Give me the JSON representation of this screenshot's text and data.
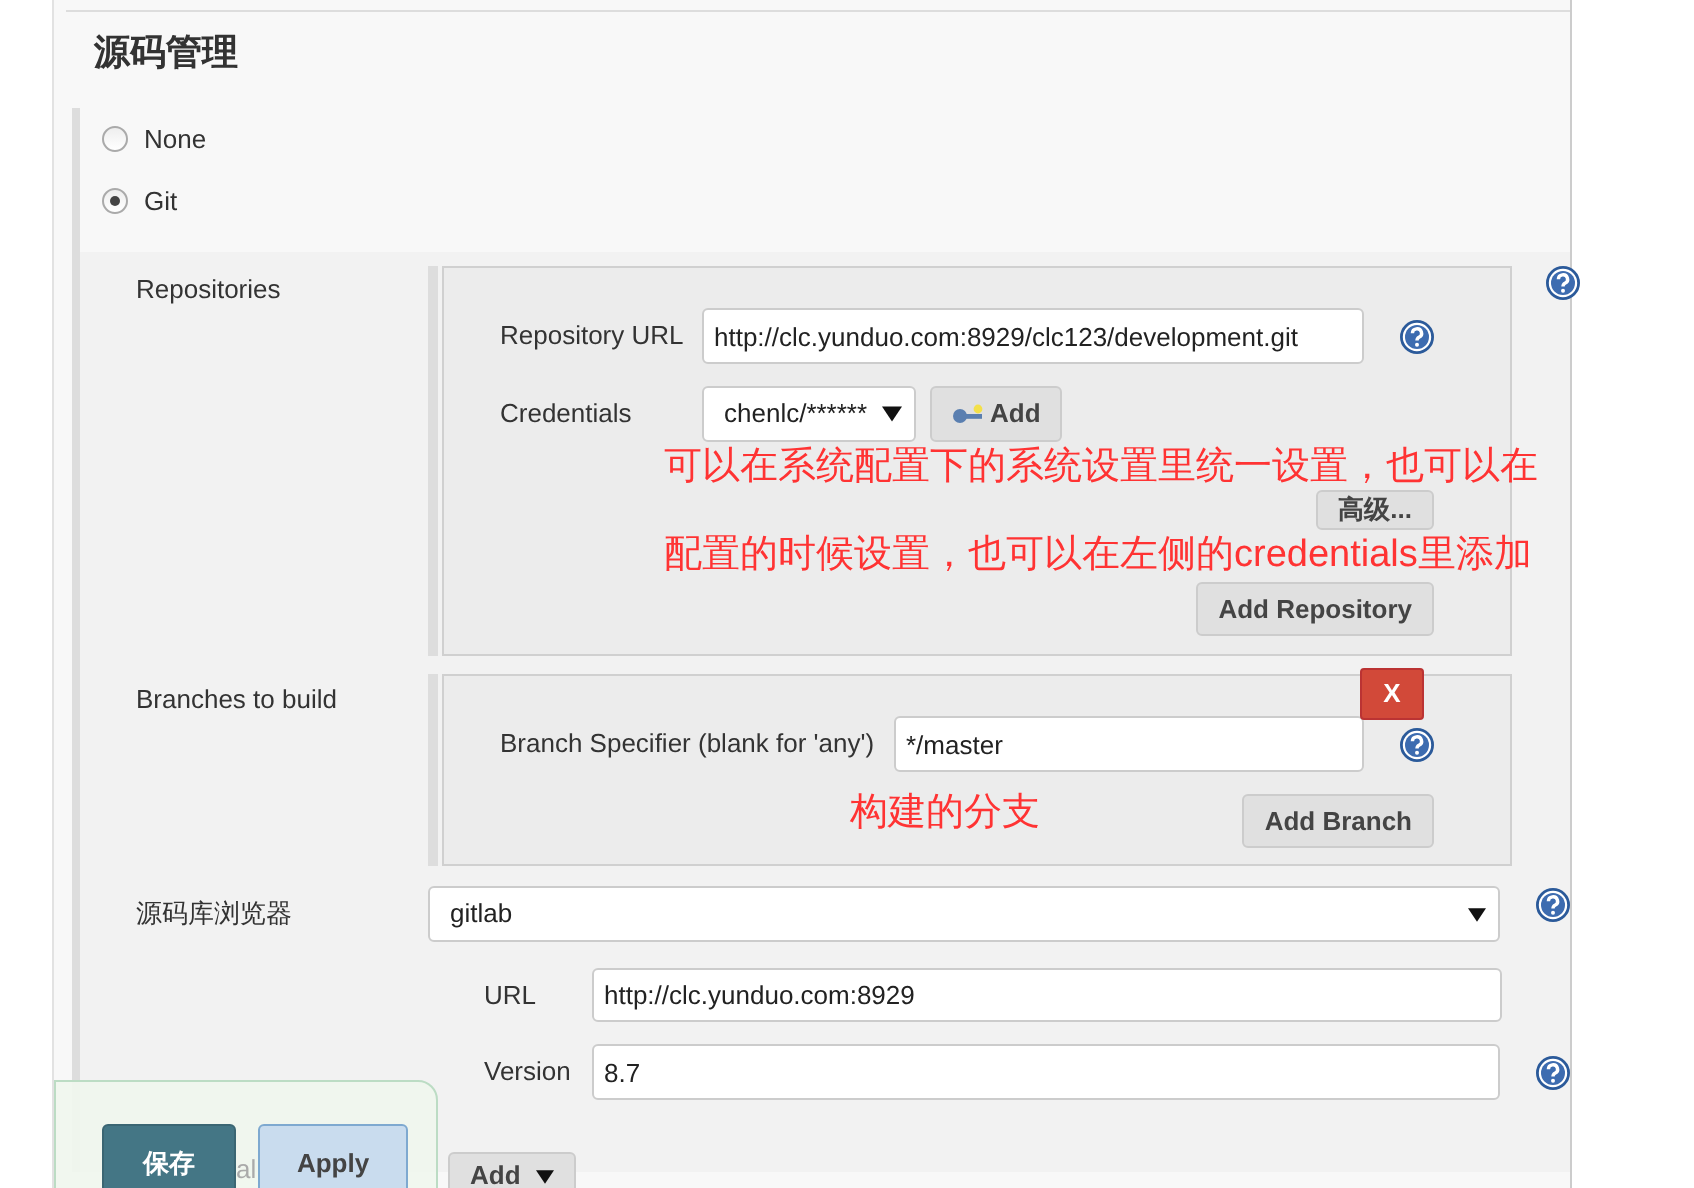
{
  "section_title": "源码管理",
  "scm_options": [
    {
      "label": "None",
      "selected": false
    },
    {
      "label": "Git",
      "selected": true
    }
  ],
  "repositories": {
    "label": "Repositories",
    "url_label": "Repository URL",
    "url": "http://clc.yunduo.com:8929/clc123/development.git",
    "credentials_label": "Credentials",
    "credentials": "chenlc/******",
    "add_button": "Add",
    "advanced_button": "高级...",
    "add_repository_button": "Add Repository",
    "note": [
      "可以在系统配置下的系统设置里统一设置，也可以在",
      "配置的时候设置，也可以在左侧的credentials里添加"
    ]
  },
  "branches": {
    "label": "Branches to build",
    "delete_button": "X",
    "specifier_label": "Branch Specifier (blank for 'any')",
    "specifier": "*/master",
    "note": "构建的分支",
    "add_branch_button": "Add Branch"
  },
  "browser": {
    "label": "源码库浏览器",
    "value": "gitlab",
    "url_label": "URL",
    "url": "http://clc.yunduo.com:8929",
    "version_label": "Version",
    "version": "8.7"
  },
  "footer": {
    "hidden_label": "al",
    "add_button": "Add",
    "save_button": "保存",
    "apply_button": "Apply"
  }
}
